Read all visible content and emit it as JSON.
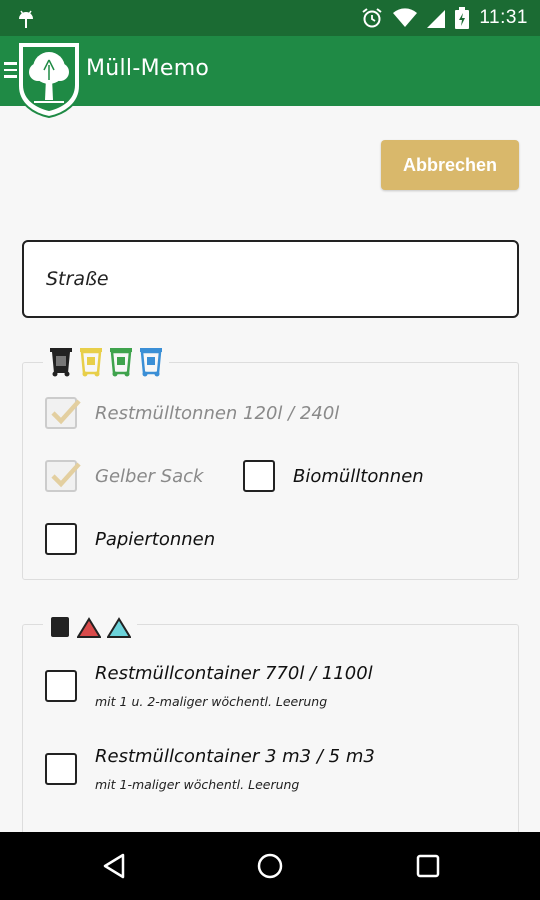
{
  "status_bar": {
    "time": "11:31",
    "icons": [
      "android-debug-icon",
      "alarm-icon",
      "wifi-icon",
      "signal-icon",
      "battery-icon"
    ]
  },
  "app_bar": {
    "title": "Müll-Memo",
    "logo": "tree-crest-icon",
    "menu_icon": "hamburger-icon"
  },
  "cancel_label": "Abbrechen",
  "street_field": {
    "placeholder": "Straße",
    "value": ""
  },
  "bins_group": {
    "legend_icons": [
      "black-bin-icon",
      "yellow-bin-icon",
      "green-bin-icon",
      "blue-bin-icon"
    ],
    "items": [
      {
        "label": "Restmülltonnen 120l / 240l",
        "checked": true,
        "enabled": false
      },
      {
        "label": "Gelber Sack",
        "checked": true,
        "enabled": false
      },
      {
        "label": "Biomülltonnen",
        "checked": false,
        "enabled": true
      },
      {
        "label": "Papiertonnen",
        "checked": false,
        "enabled": true
      }
    ]
  },
  "containers_group": {
    "legend_icons": [
      "black-container-icon",
      "red-triangle-icon",
      "cyan-triangle-icon"
    ],
    "items": [
      {
        "label": "Restmüllcontainer 770l / 1100l",
        "sublabel": "mit 1 u. 2-maliger wöchentl. Leerung",
        "checked": false
      },
      {
        "label": "Restmüllcontainer 3 m3 / 5 m3",
        "sublabel": "mit 1-maliger wöchentl. Leerung",
        "checked": false
      }
    ]
  },
  "colors": {
    "status_bar": "#1b6b33",
    "app_bar": "#1f8a45",
    "cancel_button": "#d9b86b",
    "check_mark": "#e3cfa0"
  }
}
